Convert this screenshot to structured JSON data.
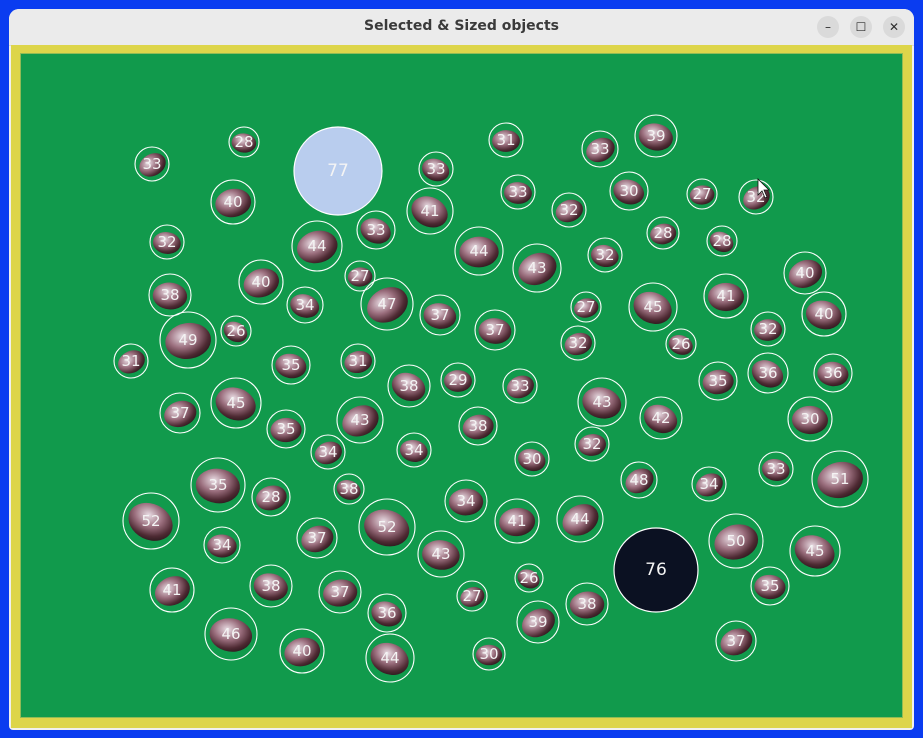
{
  "window": {
    "title": "Selected & Sized objects",
    "buttons": {
      "minimize": "–",
      "maximize": "☐",
      "close": "✕"
    }
  },
  "colors": {
    "desktop": "#0a3cf0",
    "frame": "#ddd54a",
    "cloth": "#119a4c",
    "circle": "#ffffff",
    "reference_light": "#b9cdee",
    "reference_dark": "#0b1122",
    "oyster_shell": "#7a4a55"
  },
  "objects": [
    {
      "label": "33"
    },
    {
      "label": "28"
    },
    {
      "label": "77"
    },
    {
      "label": "33"
    },
    {
      "label": "31"
    },
    {
      "label": "33"
    },
    {
      "label": "39"
    },
    {
      "label": "40"
    },
    {
      "label": "41"
    },
    {
      "label": "33"
    },
    {
      "label": "32"
    },
    {
      "label": "30"
    },
    {
      "label": "27"
    },
    {
      "label": "32"
    },
    {
      "label": "32"
    },
    {
      "label": "44"
    },
    {
      "label": "33"
    },
    {
      "label": "44"
    },
    {
      "label": "43"
    },
    {
      "label": "32"
    },
    {
      "label": "28"
    },
    {
      "label": "28"
    },
    {
      "label": "38"
    },
    {
      "label": "40"
    },
    {
      "label": "34"
    },
    {
      "label": "27"
    },
    {
      "label": "47"
    },
    {
      "label": "37"
    },
    {
      "label": "27"
    },
    {
      "label": "45"
    },
    {
      "label": "41"
    },
    {
      "label": "40"
    },
    {
      "label": "40"
    },
    {
      "label": "49"
    },
    {
      "label": "26"
    },
    {
      "label": "37"
    },
    {
      "label": "32"
    },
    {
      "label": "26"
    },
    {
      "label": "32"
    },
    {
      "label": "31"
    },
    {
      "label": "35"
    },
    {
      "label": "31"
    },
    {
      "label": "38"
    },
    {
      "label": "29"
    },
    {
      "label": "33"
    },
    {
      "label": "43"
    },
    {
      "label": "35"
    },
    {
      "label": "36"
    },
    {
      "label": "36"
    },
    {
      "label": "37"
    },
    {
      "label": "45"
    },
    {
      "label": "35"
    },
    {
      "label": "43"
    },
    {
      "label": "34"
    },
    {
      "label": "38"
    },
    {
      "label": "42"
    },
    {
      "label": "30"
    },
    {
      "label": "34"
    },
    {
      "label": "30"
    },
    {
      "label": "32"
    },
    {
      "label": "48"
    },
    {
      "label": "35"
    },
    {
      "label": "28"
    },
    {
      "label": "38"
    },
    {
      "label": "34"
    },
    {
      "label": "34"
    },
    {
      "label": "33"
    },
    {
      "label": "51"
    },
    {
      "label": "52"
    },
    {
      "label": "34"
    },
    {
      "label": "37"
    },
    {
      "label": "52"
    },
    {
      "label": "41"
    },
    {
      "label": "44"
    },
    {
      "label": "43"
    },
    {
      "label": "50"
    },
    {
      "label": "45"
    },
    {
      "label": "76"
    },
    {
      "label": "41"
    },
    {
      "label": "38"
    },
    {
      "label": "37"
    },
    {
      "label": "26"
    },
    {
      "label": "35"
    },
    {
      "label": "27"
    },
    {
      "label": "36"
    },
    {
      "label": "38"
    },
    {
      "label": "39"
    },
    {
      "label": "46"
    },
    {
      "label": "40"
    },
    {
      "label": "44"
    },
    {
      "label": "30"
    },
    {
      "label": "37"
    }
  ],
  "cursor": "mouse-pointer-icon"
}
